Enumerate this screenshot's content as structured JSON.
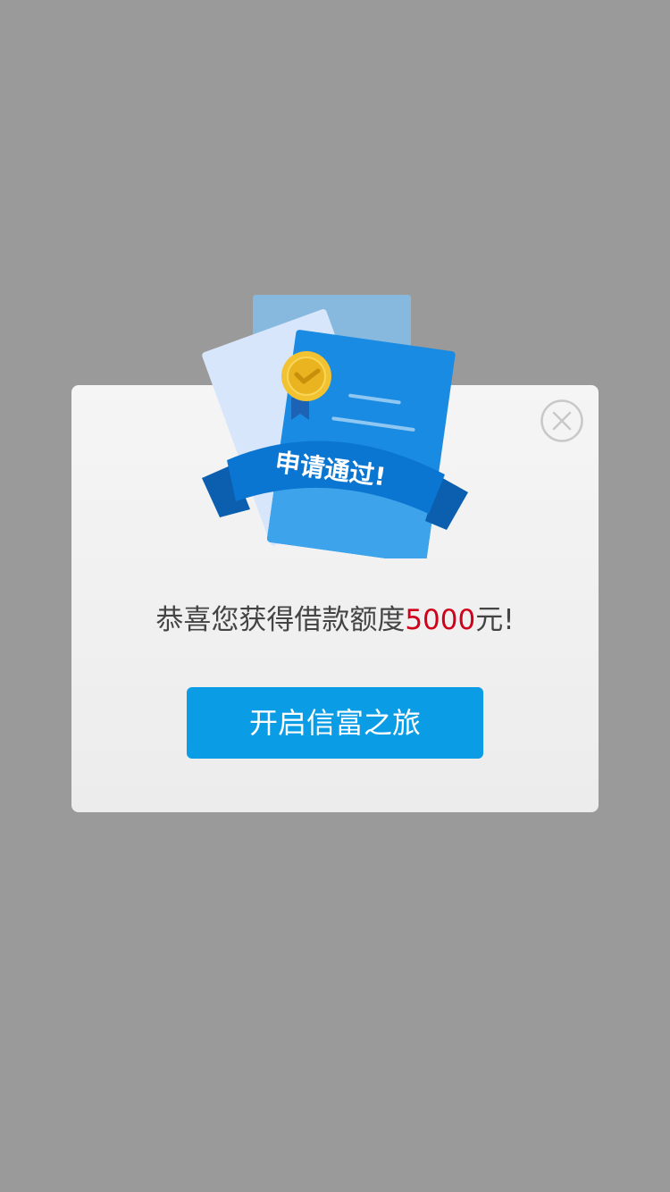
{
  "banner": {
    "text": "申请通过!"
  },
  "message": {
    "prefix": "恭喜您获得借款额度",
    "amount": "5000",
    "suffix": "元!"
  },
  "button": {
    "label": "开启信富之旅"
  },
  "icons": {
    "close": "close-icon",
    "illustration": "approved-document-illustration",
    "badge": "check-medal-icon"
  },
  "colors": {
    "overlay": "#9a9a9a",
    "button": "#0a9de5",
    "amount": "#d0021b",
    "ribbon": "#0b76d1"
  }
}
